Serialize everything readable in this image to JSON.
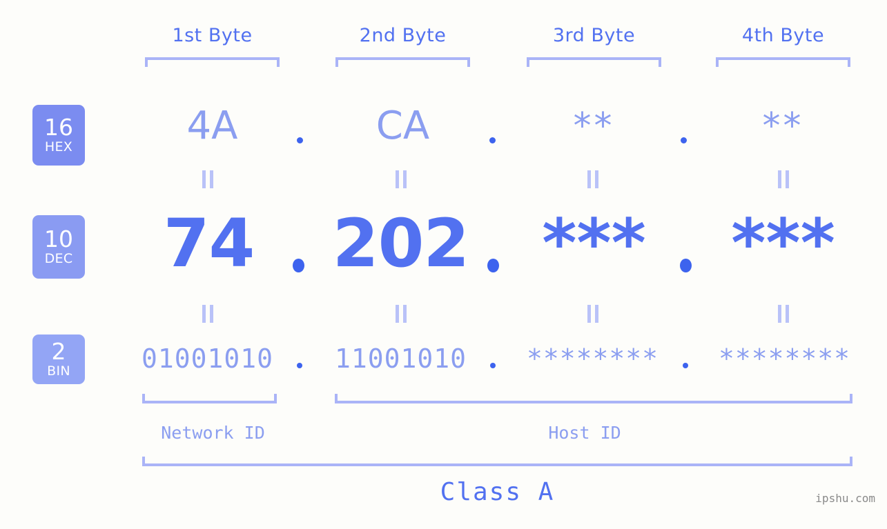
{
  "background_color": "#fdfdfa",
  "accent_strong": "#5271f0",
  "accent_light": "#8b9ef0",
  "accent_bracket": "#aab4f7",
  "columns": [
    {
      "header": "1st Byte",
      "hex": "4A",
      "dec": "74",
      "bin": "01001010"
    },
    {
      "header": "2nd Byte",
      "hex": "CA",
      "dec": "202",
      "bin": "11001010"
    },
    {
      "header": "3rd Byte",
      "hex": "**",
      "dec": "***",
      "bin": "********"
    },
    {
      "header": "4th Byte",
      "hex": "**",
      "dec": "***",
      "bin": "********"
    }
  ],
  "rows": [
    {
      "base": "16",
      "system": "HEX"
    },
    {
      "base": "10",
      "system": "DEC"
    },
    {
      "base": "2",
      "system": "BIN"
    }
  ],
  "separators": {
    "dot": ".",
    "equals": "="
  },
  "regions": {
    "network_id": "Network ID",
    "host_id": "Host ID",
    "class": "Class A"
  },
  "watermark": "ipshu.com"
}
